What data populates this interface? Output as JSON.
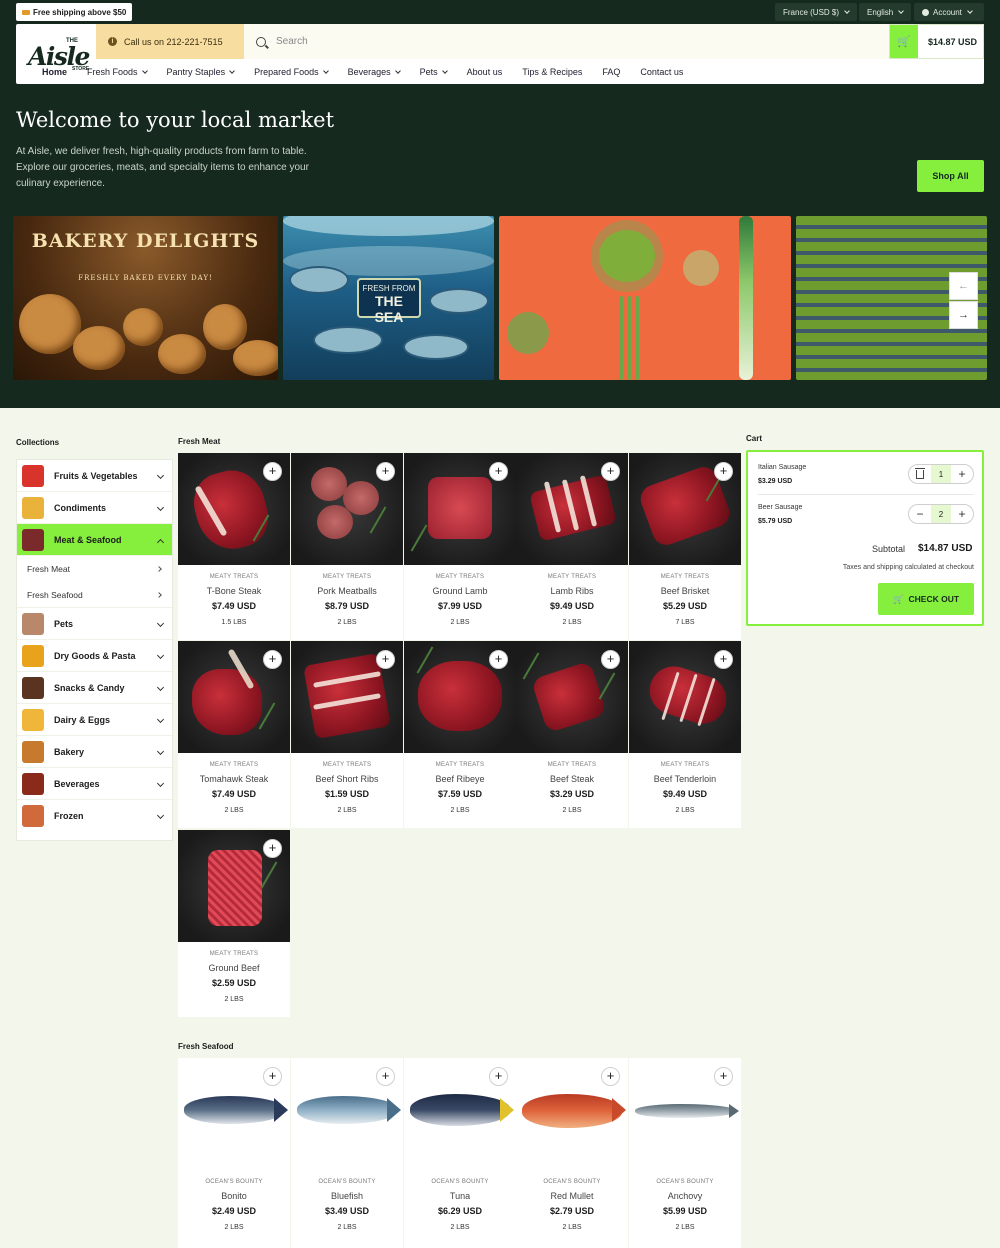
{
  "topbar": {
    "shipping_badge": "Free shipping above $50",
    "region": "France (USD $)",
    "language": "English",
    "account": "Account"
  },
  "header": {
    "logo_the": "THE",
    "logo_name": "Aisle",
    "logo_store": "STORE",
    "call_text": "Call us on 212-221-7515",
    "search_placeholder": "Search",
    "cart_total": "$14.87 USD"
  },
  "nav": [
    {
      "label": "Home",
      "dropdown": false
    },
    {
      "label": "Fresh Foods",
      "dropdown": true
    },
    {
      "label": "Pantry Staples",
      "dropdown": true
    },
    {
      "label": "Prepared Foods",
      "dropdown": true
    },
    {
      "label": "Beverages",
      "dropdown": true
    },
    {
      "label": "Pets",
      "dropdown": true
    },
    {
      "label": "About us",
      "dropdown": false
    },
    {
      "label": "Tips & Recipes",
      "dropdown": false
    },
    {
      "label": "FAQ",
      "dropdown": false
    },
    {
      "label": "Contact us",
      "dropdown": false
    }
  ],
  "hero": {
    "title": "Welcome to your local market",
    "text": "At Aisle, we deliver fresh, high-quality products from farm to table. Explore our groceries, meats, and specialty items to enhance your culinary experience.",
    "shop_all": "Shop All",
    "banners": {
      "bakery_title": "BAKERY DELIGHTS",
      "bakery_sub": "FRESHLY BAKED EVERY DAY!",
      "sea_line1": "FRESH FROM",
      "sea_line2": "THE SEA"
    }
  },
  "sidebar": {
    "heading": "Collections",
    "items": [
      {
        "label": "Fruits & Vegetables",
        "color": "#d9342b"
      },
      {
        "label": "Condiments",
        "color": "#e9b23a"
      },
      {
        "label": "Meat & Seafood",
        "color": "#7a2a2a"
      },
      {
        "label": "Pets",
        "color": "#b9876a"
      },
      {
        "label": "Dry Goods & Pasta",
        "color": "#e8a21c"
      },
      {
        "label": "Snacks & Candy",
        "color": "#5a3420"
      },
      {
        "label": "Dairy & Eggs",
        "color": "#f0b63a"
      },
      {
        "label": "Bakery",
        "color": "#c77a2e"
      },
      {
        "label": "Beverages",
        "color": "#8a2a1a"
      },
      {
        "label": "Frozen",
        "color": "#d06a3a"
      }
    ],
    "sub_items": [
      "Fresh Meat",
      "Fresh Seafood"
    ]
  },
  "sections": {
    "fresh_meat": "Fresh Meat",
    "fresh_seafood": "Fresh Seafood",
    "cart": "Cart"
  },
  "products_meat": [
    {
      "brand": "MEATY TREATS",
      "name": "T-Bone Steak",
      "price": "$7.49 USD",
      "weight": "1.5 LBS"
    },
    {
      "brand": "MEATY TREATS",
      "name": "Pork Meatballs",
      "price": "$8.79 USD",
      "weight": "2 LBS"
    },
    {
      "brand": "MEATY TREATS",
      "name": "Ground Lamb",
      "price": "$7.99 USD",
      "weight": "2 LBS"
    },
    {
      "brand": "MEATY TREATS",
      "name": "Lamb Ribs",
      "price": "$9.49 USD",
      "weight": "2 LBS"
    },
    {
      "brand": "MEATY TREATS",
      "name": "Beef Brisket",
      "price": "$5.29 USD",
      "weight": "7 LBS"
    },
    {
      "brand": "MEATY TREATS",
      "name": "Tomahawk Steak",
      "price": "$7.49 USD",
      "weight": "2 LBS"
    },
    {
      "brand": "MEATY TREATS",
      "name": "Beef Short Ribs",
      "price": "$1.59 USD",
      "weight": "2 LBS"
    },
    {
      "brand": "MEATY TREATS",
      "name": "Beef Ribeye",
      "price": "$7.59 USD",
      "weight": "2 LBS"
    },
    {
      "brand": "MEATY TREATS",
      "name": "Beef Steak",
      "price": "$3.29 USD",
      "weight": "2 LBS"
    },
    {
      "brand": "MEATY TREATS",
      "name": "Beef Tenderloin",
      "price": "$9.49 USD",
      "weight": "2 LBS"
    },
    {
      "brand": "MEATY TREATS",
      "name": "Ground Beef",
      "price": "$2.59 USD",
      "weight": "2 LBS"
    }
  ],
  "products_seafood": [
    {
      "brand": "OCEAN'S BOUNTY",
      "name": "Bonito",
      "price": "$2.49 USD",
      "weight": "2 LBS",
      "color": "#5a6e86"
    },
    {
      "brand": "OCEAN'S BOUNTY",
      "name": "Bluefish",
      "price": "$3.49 USD",
      "weight": "2 LBS",
      "color": "#6f8fa8"
    },
    {
      "brand": "OCEAN'S BOUNTY",
      "name": "Tuna",
      "price": "$6.29 USD",
      "weight": "2 LBS",
      "color": "#3a4a66"
    },
    {
      "brand": "OCEAN'S BOUNTY",
      "name": "Red Mullet",
      "price": "$2.79 USD",
      "weight": "2 LBS",
      "color": "#d6553a"
    },
    {
      "brand": "OCEAN'S BOUNTY",
      "name": "Anchovy",
      "price": "$5.99 USD",
      "weight": "2 LBS",
      "color": "#9aa6ae"
    }
  ],
  "cart": {
    "items": [
      {
        "name": "Italian Sausage",
        "price": "$3.29 USD",
        "qty": "1"
      },
      {
        "name": "Beer Sausage",
        "price": "$5.79 USD",
        "qty": "2"
      }
    ],
    "subtotal_label": "Subtotal",
    "subtotal_value": "$14.87 USD",
    "tax_note": "Taxes and shipping calculated at checkout",
    "checkout_label": "CHECK OUT"
  },
  "colors": {
    "dark_green": "#16291f",
    "accent_green": "#86ef3e",
    "background": "#f3f6ea"
  }
}
